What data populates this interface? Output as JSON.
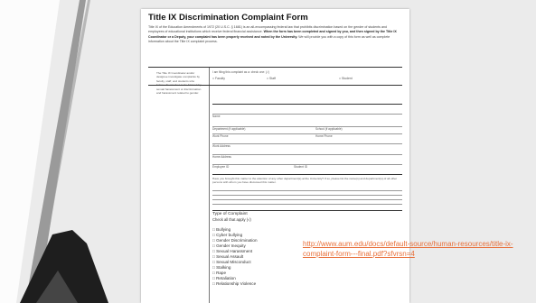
{
  "form": {
    "title": "Title IX Discrimination Complaint Form",
    "intro_normal_1": "Title IX of the Education Amendments of 1972 (20 U.S.C. § 1681) is an all-encompassing federal law that prohibits discrimination based on the gender of students and employees of educational institutions which receive federal financial assistance. ",
    "intro_bold": "When the form has been completed and signed by you, and then signed by the Title IX Coordinator or a Deputy, your complaint has been properly received and noted by the University.",
    "intro_normal_2": " We will provide you with a copy of this form as well as complete information about the Title IX complaint process.",
    "side_note": "The Title IX Coordinator and/or designee investigate complaints by faculty, staff, and students who believe themselves to be harmed by sexual harassment or discrimination and harassment related to gender.",
    "filing_as_label": "I am filing this complaint as a: check one: (√)",
    "filing_options": [
      "Faculty",
      "Staff",
      "Student"
    ],
    "checkbox_glyph": "□",
    "fields": {
      "name": "Name",
      "department": "Department (if applicable)",
      "school": "School (if applicable)",
      "work_phone": "Work Phone",
      "home_phone": "Home Phone",
      "work_address": "Work Address",
      "home_address": "Home Address",
      "employee_id": "Employee ID",
      "student_id": "Student ID"
    },
    "prior_question": "Have you brought this matter to the attention of any other department(s) at the University? If so, please list the name(s) and department(s) of all other persons with whom you have discussed this matter.",
    "complaint_type_title": "Type of Complaint",
    "complaint_type_subtitle": "Check all that apply (√)",
    "complaint_types": [
      "Bullying",
      "Cyber bullying",
      "Gender Discrimination",
      "Gender Inequity",
      "Sexual Harassment",
      "Sexual Assault",
      "Sexual Misconduct",
      "Stalking",
      "Rape",
      "Retaliation",
      "Relationship Violence"
    ]
  },
  "link": {
    "text": "http://www.aum.edu/docs/default-source/human-resources/title-ix-complaint-form---final.pdf?sfvrsn=4",
    "color": "#e8703a"
  },
  "colors": {
    "background": "#ebebeb",
    "stripe_dark": "#1e1e1e",
    "stripe_gray": "#9a9a9a",
    "accent": "#e8703a"
  }
}
